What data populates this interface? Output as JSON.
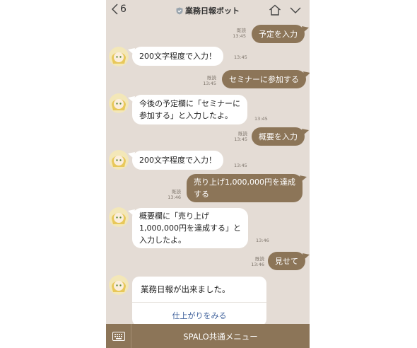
{
  "header": {
    "back_count": "6",
    "title": "業務日報ボット"
  },
  "messages": [
    {
      "sender": "user",
      "text": "予定を入力",
      "read": "既読",
      "time": "13:45"
    },
    {
      "sender": "bot",
      "text": "200文字程度で入力！",
      "time": "13:45"
    },
    {
      "sender": "user",
      "text": "セミナーに参加する",
      "read": "既読",
      "time": "13:45"
    },
    {
      "sender": "bot",
      "lines": [
        "今後の予定欄に「セミナーに",
        "参加する」と入力したよ。"
      ],
      "time": "13:45"
    },
    {
      "sender": "user",
      "text": "概要を入力",
      "read": "既読",
      "time": "13:45"
    },
    {
      "sender": "bot",
      "text": "200文字程度で入力！",
      "time": "13:45"
    },
    {
      "sender": "user",
      "lines": [
        "売り上げ1,000,000円を達成",
        "する"
      ],
      "read": "既読",
      "time": "13:46"
    },
    {
      "sender": "bot",
      "lines": [
        "概要欄に「売り上げ",
        "1,000,000円を達成する」と",
        "入力したよ。"
      ],
      "time": "13:46"
    },
    {
      "sender": "user",
      "text": "見せて",
      "read": "既読",
      "time": "13:46"
    }
  ],
  "card": {
    "title": "業務日報が出来ました。",
    "link": "仕上がりをみる"
  },
  "bottom_menu": {
    "label": "SPALO共通メニュー"
  },
  "colors": {
    "background": "#e4dcd5",
    "user_bubble": "#8c7558",
    "bot_bubble": "#ffffff",
    "link": "#3d5f9a"
  }
}
